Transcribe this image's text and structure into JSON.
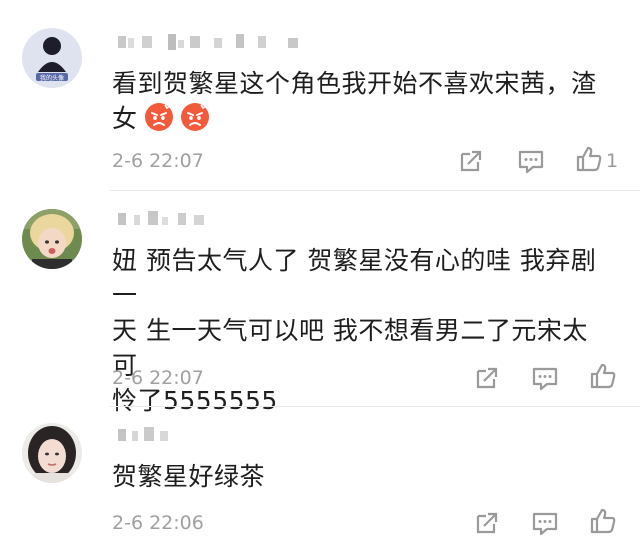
{
  "comments": [
    {
      "avatar": "avatar-fan-illustration",
      "text_line1": "看到贺繁星这个角色我开始不喜欢宋茜，渣",
      "text_line2": "女",
      "emojis": [
        "angry-face-emoji",
        "angry-face-emoji"
      ],
      "time": "2-6 22:07",
      "like_count": "1"
    },
    {
      "avatar": "avatar-blonde-person",
      "text_line1": "妞 预告太气人了 贺繁星没有心的哇 我弃剧一",
      "text_line2": "天 生一天气可以吧 我不想看男二了元宋太可",
      "text_line3": "怜了5555555",
      "time": "2-6 22:07"
    },
    {
      "avatar": "avatar-girl-photo",
      "text_line1": "贺繁星好绿茶",
      "time": "2-6 22:06"
    }
  ],
  "icons": {
    "share": "share-icon",
    "comment": "comment-icon",
    "like": "thumbs-up-icon"
  },
  "colors": {
    "time": "#a0a0a0",
    "icon": "#9a9a9a",
    "divider": "#e9e9e9"
  }
}
